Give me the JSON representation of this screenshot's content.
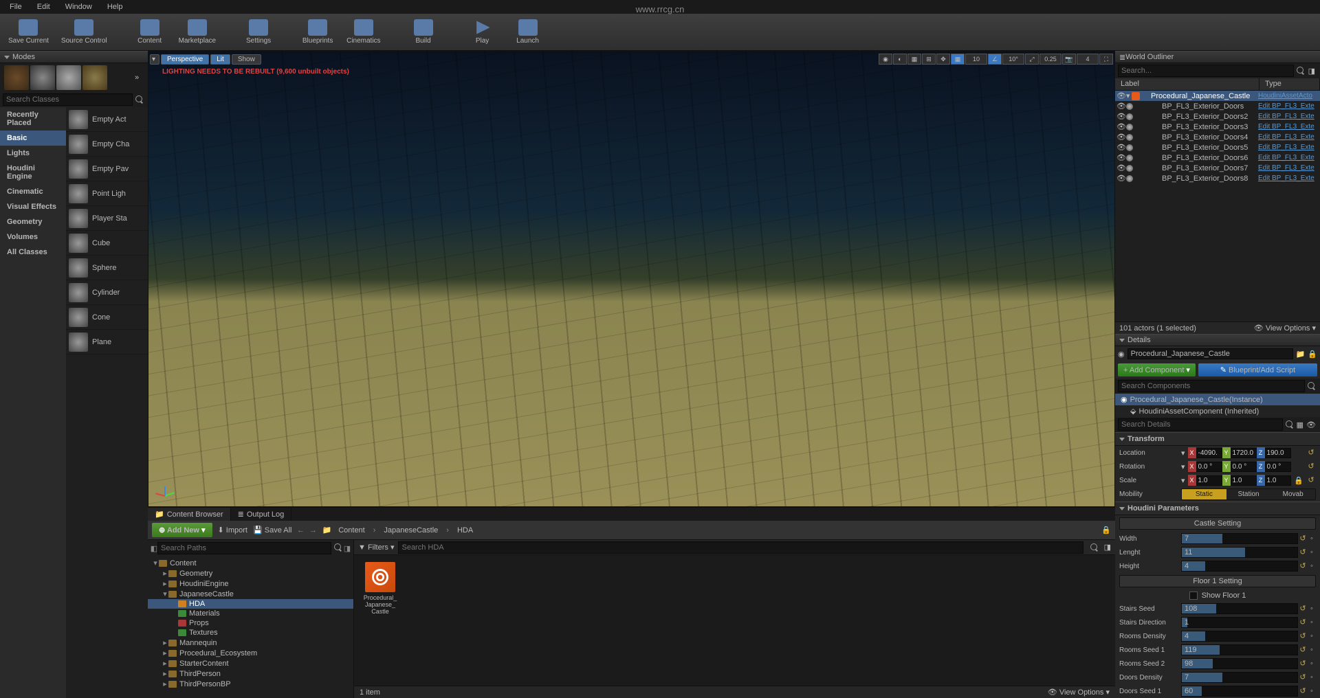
{
  "menubar": [
    "File",
    "Edit",
    "Window",
    "Help"
  ],
  "watermark": "www.rrcg.cn",
  "toolbar": [
    {
      "label": "Save Current",
      "ico": "ico-save"
    },
    {
      "label": "Source Control",
      "ico": "ico-src"
    },
    {
      "label": "Content",
      "ico": "ico-content"
    },
    {
      "label": "Marketplace",
      "ico": "ico-market"
    },
    {
      "label": "Settings",
      "ico": "ico-settings"
    },
    {
      "label": "Blueprints",
      "ico": "ico-bp"
    },
    {
      "label": "Cinematics",
      "ico": "ico-cine"
    },
    {
      "label": "Build",
      "ico": "ico-build"
    },
    {
      "label": "Play",
      "ico": "ico-play"
    },
    {
      "label": "Launch",
      "ico": "ico-launch"
    }
  ],
  "modes_title": "Modes",
  "search_classes_ph": "Search Classes",
  "place_cats": [
    "Recently Placed",
    "Basic",
    "Lights",
    "Houdini Engine",
    "Cinematic",
    "Visual Effects",
    "Geometry",
    "Volumes",
    "All Classes"
  ],
  "place_items": [
    "Empty Act",
    "Empty Cha",
    "Empty Pav",
    "Point Ligh",
    "Player Sta",
    "Cube",
    "Sphere",
    "Cylinder",
    "Cone",
    "Plane"
  ],
  "viewport": {
    "btn_persp": "Perspective",
    "btn_lit": "Lit",
    "btn_show": "Show",
    "warn": "LIGHTING NEEDS TO BE REBUILT (9,600 unbuilt objects)",
    "snap": {
      "pos": "10",
      "rot": "10°",
      "scale": "0.25"
    }
  },
  "cb": {
    "tab1": "Content Browser",
    "tab2": "Output Log",
    "add": "Add New",
    "import": "Import",
    "save": "Save All",
    "crumbs": [
      "Content",
      "JapaneseCastle",
      "HDA"
    ],
    "search_paths_ph": "Search Paths",
    "filters": "Filters",
    "search_hda_ph": "Search HDA",
    "tree": [
      {
        "n": "Content",
        "d": 0,
        "e": "▾"
      },
      {
        "n": "Geometry",
        "d": 1,
        "e": "▸"
      },
      {
        "n": "HoudiniEngine",
        "d": 1,
        "e": "▸"
      },
      {
        "n": "JapaneseCastle",
        "d": 1,
        "e": "▾"
      },
      {
        "n": "HDA",
        "d": 2,
        "sel": true,
        "c": "#d08020"
      },
      {
        "n": "Materials",
        "d": 2,
        "c": "#3a8a3a"
      },
      {
        "n": "Props",
        "d": 2,
        "c": "#a83838"
      },
      {
        "n": "Textures",
        "d": 2,
        "c": "#3a8a3a"
      },
      {
        "n": "Mannequin",
        "d": 1,
        "e": "▸"
      },
      {
        "n": "Procedural_Ecosystem",
        "d": 1,
        "e": "▸"
      },
      {
        "n": "StarterContent",
        "d": 1,
        "e": "▸"
      },
      {
        "n": "ThirdPerson",
        "d": 1,
        "e": "▸"
      },
      {
        "n": "ThirdPersonBP",
        "d": 1,
        "e": "▸"
      }
    ],
    "asset": "Procedural_\nJapanese_\nCastle",
    "status": "1 item",
    "view_opts": "View Options"
  },
  "outliner": {
    "title": "World Outliner",
    "search_ph": "Search...",
    "cols": {
      "label": "Label",
      "type": "Type"
    },
    "rows": [
      {
        "n": "Procedural_Japanese_Castle",
        "t": "HoudiniAssetActo",
        "sel": true,
        "ico": "h"
      },
      {
        "n": "BP_FL3_Exterior_Doors",
        "t": "Edit BP_FL3_Exte"
      },
      {
        "n": "BP_FL3_Exterior_Doors2",
        "t": "Edit BP_FL3_Exte"
      },
      {
        "n": "BP_FL3_Exterior_Doors3",
        "t": "Edit BP_FL3_Exte"
      },
      {
        "n": "BP_FL3_Exterior_Doors4",
        "t": "Edit BP_FL3_Exte"
      },
      {
        "n": "BP_FL3_Exterior_Doors5",
        "t": "Edit BP_FL3_Exte"
      },
      {
        "n": "BP_FL3_Exterior_Doors6",
        "t": "Edit BP_FL3_Exte"
      },
      {
        "n": "BP_FL3_Exterior_Doors7",
        "t": "Edit BP_FL3_Exte"
      },
      {
        "n": "BP_FL3_Exterior_Doors8",
        "t": "Edit BP_FL3_Exte"
      }
    ],
    "foot": "101 actors (1 selected)",
    "view_opts": "View Options"
  },
  "details": {
    "title": "Details",
    "actor": "Procedural_Japanese_Castle",
    "add_comp": "+ Add Component",
    "bp_edit": "Blueprint/Add Script",
    "search_comp_ph": "Search Components",
    "search_det_ph": "Search Details",
    "comp_root": "Procedural_Japanese_Castle(Instance)",
    "comp_child": "HoudiniAssetComponent (Inherited)",
    "transform": {
      "title": "Transform",
      "loc": {
        "k": "Location",
        "x": "-4090.",
        "y": "1720.0",
        "z": "190.0"
      },
      "rot": {
        "k": "Rotation",
        "x": "0.0 °",
        "y": "0.0 °",
        "z": "0.0 °"
      },
      "scl": {
        "k": "Scale",
        "x": "1.0",
        "y": "1.0",
        "z": "1.0"
      },
      "mob": {
        "k": "Mobility",
        "a": "Static",
        "b": "Station",
        "c": "Movab"
      }
    },
    "houdini": {
      "title": "Houdini Parameters",
      "castle_hdr": "Castle Setting",
      "width": {
        "k": "Width",
        "v": "7",
        "p": 35
      },
      "length": {
        "k": "Lenght",
        "v": "11",
        "p": 55
      },
      "height": {
        "k": "Height",
        "v": "4",
        "p": 20
      },
      "fl1_hdr": "Floor 1 Setting",
      "show_fl1": "Show Floor 1",
      "stairs_seed": {
        "k": "Stairs Seed",
        "v": "108",
        "p": 30
      },
      "stairs_dir": {
        "k": "Stairs Direction",
        "v": "1",
        "p": 5
      },
      "rooms_den": {
        "k": "Rooms Density",
        "v": "4",
        "p": 20
      },
      "rooms_s1": {
        "k": "Rooms Seed 1",
        "v": "119",
        "p": 33
      },
      "rooms_s2": {
        "k": "Rooms Seed 2",
        "v": "98",
        "p": 27
      },
      "doors_den": {
        "k": "Doors Density",
        "v": "7",
        "p": 35
      },
      "doors_s1": {
        "k": "Doors Seed 1",
        "v": "60",
        "p": 17
      }
    }
  }
}
